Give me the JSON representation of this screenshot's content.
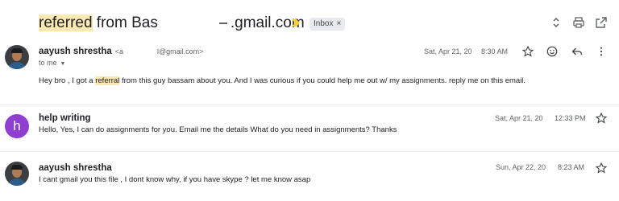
{
  "subject": {
    "part1": "referred",
    "part2": " from Bas",
    "part3": ".gmail.com",
    "label": "Inbox",
    "label_close": "×"
  },
  "messages": [
    {
      "sender": "aayush shrestha",
      "email_start": "<a",
      "email_end": "l@gmail.com>",
      "to": "to me",
      "date": "Sat, Apr 21, 20",
      "time": "8:30 AM",
      "body_before": "Hey bro , I got a ",
      "body_highlight": "referral",
      "body_after": " from this guy bassam about you. And I was curious if you could help me out w/ my assignments. reply me on this email.",
      "avatar": "photo"
    },
    {
      "sender": "help writing",
      "date": "Sat, Apr 21, 20",
      "time": "12:33 PM",
      "snippet": "Hello, Yes, I can do assignments for you. Email me the details What do you need in assignments? Thanks",
      "avatar_letter": "h"
    },
    {
      "sender": "aayush shrestha",
      "date": "Sun, Apr 22, 20",
      "time": "8:23 AM",
      "snippet": "I cant gmail you this file , I dont know why, if you have skype ? let me know asap",
      "avatar": "photo"
    }
  ],
  "icons": {
    "expand": "expand-collapse-icon",
    "print": "print-icon",
    "new_window": "open-in-new-window-icon",
    "star": "star-icon",
    "emoji": "emoji-reaction-icon",
    "reply": "reply-icon",
    "more": "more-vert-icon",
    "important": "important-marker-icon"
  },
  "colors": {
    "highlight": "#fce8b2",
    "avatar_letter_bg": "#8e3fd1",
    "important_marker": "#f4d03f"
  }
}
